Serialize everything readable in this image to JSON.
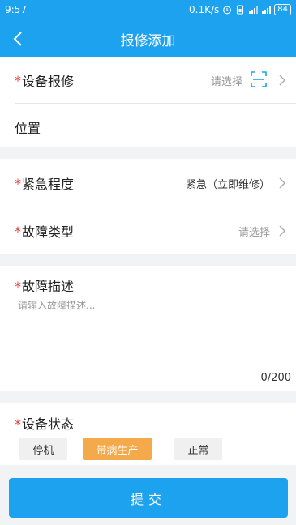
{
  "status_bar": {
    "time": "9:57",
    "speed": "0.1K/s",
    "battery": "84"
  },
  "header": {
    "title": "报修添加"
  },
  "form": {
    "required_mark": "*",
    "device": {
      "label": "设备报修",
      "placeholder": "请选择"
    },
    "location": {
      "label": "位置"
    },
    "urgency": {
      "label": "紧急程度",
      "value": "紧急（立即维修）"
    },
    "fault_type": {
      "label": "故障类型",
      "placeholder": "请选择"
    },
    "description": {
      "label": "故障描述",
      "placeholder": "请输入故障描述...",
      "counter": "0/200"
    },
    "device_status": {
      "label": "设备状态",
      "options": [
        {
          "label": "停机",
          "selected": false
        },
        {
          "label": "带病生产",
          "selected": true
        },
        {
          "label": "正常",
          "selected": false
        }
      ]
    }
  },
  "submit_label": "提交",
  "colors": {
    "primary": "#1da2f0",
    "selected_option": "#f4aa4a",
    "required": "#e53935"
  }
}
